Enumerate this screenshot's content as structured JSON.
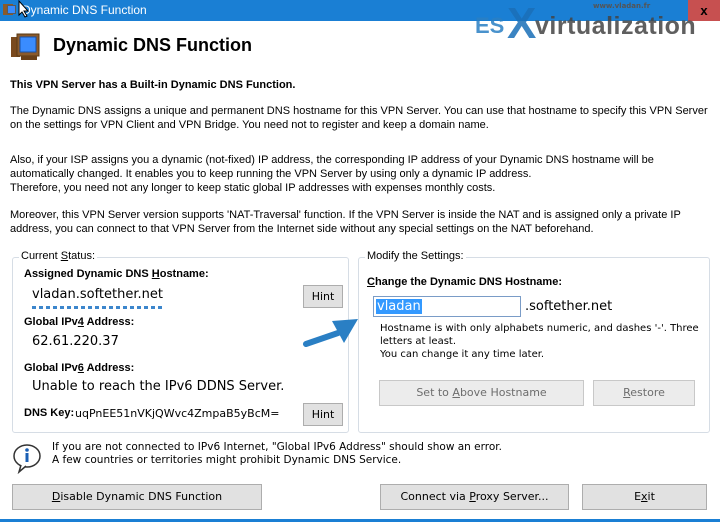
{
  "window": {
    "title": "Dynamic DNS Function",
    "close_glyph": "x"
  },
  "watermark": {
    "url": "www.vladan.fr",
    "es": "ES",
    "x": "X",
    "virtualization": "virtualization"
  },
  "header": {
    "title": "Dynamic DNS Function",
    "icon": "computer-icon"
  },
  "intro": {
    "heading": "This VPN Server has a Built-in Dynamic DNS Function.",
    "para1_line1": "The Dynamic DNS assigns a unique and permanent DNS hostname for this VPN Server. You can use that hostname to specify this VPN Server",
    "para1_line2": "on the settings for VPN Client and VPN Bridge. You need not to register and keep a domain name.",
    "para2_line1": "Also, if your ISP assigns you a dynamic (not-fixed) IP address, the corresponding IP address of your Dynamic DNS hostname will be",
    "para2_line2": "automatically changed. It enables you to keep running the VPN Server by using only a dynamic IP address.",
    "para2_line3": "Therefore, you need not any longer to keep static global IP addresses with expenses monthly costs.",
    "para3_line1": "Moreover, this VPN Server version supports 'NAT-Traversal' function. If the VPN Server is inside the NAT and is assigned only a private IP",
    "para3_line2": "address, you can connect to that VPN Server from the Internet side without any special settings on the NAT beforehand."
  },
  "current_status": {
    "group_label_pre": "Current ",
    "group_label_u": "S",
    "group_label_post": "tatus:",
    "hostname_label_pre": "Assigned Dynamic DNS ",
    "hostname_label_u": "H",
    "hostname_label_post": "ostname:",
    "hostname_value": "vladan.softether.net",
    "hint_label": "Hint",
    "ipv4_label_pre": "Global IPv",
    "ipv4_label_u": "4",
    "ipv4_label_post": " Address:",
    "ipv4_value": "62.61.220.37",
    "ipv6_label_pre": "Global IPv",
    "ipv6_label_u": "6",
    "ipv6_label_post": " Address:",
    "ipv6_value": "Unable to reach the IPv6 DDNS Server.",
    "dns_key_label": "DNS Key:",
    "dns_key_value": "uqPnEE51nVKjQWvc4ZmpaB5yBcM=",
    "hint2_label": "Hint"
  },
  "modify": {
    "group_label": "Modify the Settings:",
    "change_label_u": "C",
    "change_label_post": "hange the Dynamic DNS Hostname:",
    "hostname_input_value": "vladan",
    "domain_suffix": ".softether.net",
    "help_line1": "Hostname is with only alphabets numeric, and dashes '-'. Three",
    "help_line2": "letters at least.",
    "help_line3": "You can change it any time later.",
    "set_button_pre": "Set to ",
    "set_button_u": "A",
    "set_button_post": "bove Hostname",
    "restore_button_u": "R",
    "restore_button_post": "estore"
  },
  "info": {
    "line1": "If you are not connected to IPv6 Internet, \"Global IPv6 Address\" should show an error.",
    "line2": "A few countries or territories might prohibit Dynamic DNS Service."
  },
  "footer": {
    "disable_u": "D",
    "disable_post": "isable Dynamic DNS Function",
    "proxy_pre": "Connect via ",
    "proxy_u": "P",
    "proxy_post": "roxy Server...",
    "exit_pre": "E",
    "exit_u": "x",
    "exit_post": "it"
  },
  "colors": {
    "titlebar": "#1a7fd4",
    "close": "#c75050",
    "selection": "#3399ff",
    "annotation_arrow": "#2a7fc4"
  }
}
